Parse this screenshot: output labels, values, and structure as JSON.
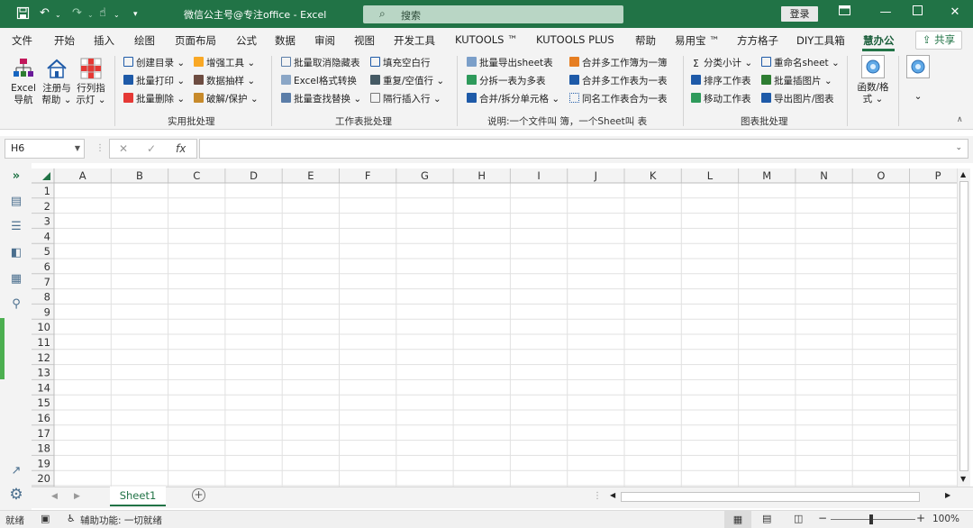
{
  "window": {
    "title": "微信公主号@专注office  -  Excel",
    "search_placeholder": "搜索",
    "login_label": "登录"
  },
  "menu": {
    "items": [
      "文件",
      "开始",
      "插入",
      "绘图",
      "页面布局",
      "公式",
      "数据",
      "审阅",
      "视图",
      "开发工具",
      "KUTOOLS ™",
      "KUTOOLS PLUS",
      "帮助",
      "易用宝 ™",
      "方方格子",
      "DIY工具箱",
      "慧办公"
    ],
    "active": "慧办公",
    "share_label": "共享"
  },
  "ribbon": {
    "big_buttons": [
      "Excel\n导航",
      "注册与\n帮助 ⌄",
      "行列指\n示灯 ⌄"
    ],
    "group1": {
      "label": "实用批处理",
      "col1": [
        "创建目录 ⌄",
        "批量打印 ⌄",
        "批量删除 ⌄"
      ],
      "col2": [
        "增强工具 ⌄",
        "数据抽样 ⌄",
        "破解/保护 ⌄"
      ]
    },
    "group2": {
      "label": "工作表批处理",
      "col1": [
        "批量取消隐藏表",
        "Excel格式转换",
        "批量查找替换 ⌄"
      ],
      "col2": [
        "填充空白行",
        "重复/空值行 ⌄",
        "隔行插入行 ⌄"
      ]
    },
    "group3": {
      "label": "说明:一个文件叫 簿，一个Sheet叫 表",
      "col1": [
        "批量导出sheet表",
        "分拆一表为多表",
        "合并/拆分单元格 ⌄"
      ],
      "col2": [
        "合并多工作簿为一簿",
        "合并多工作表为一表",
        "同名工作表合为一表"
      ]
    },
    "group4": {
      "label": "图表批处理",
      "col1": [
        "分类小计 ⌄",
        "排序工作表",
        "移动工作表"
      ],
      "col2": [
        "重命名sheet ⌄",
        "批量插图片 ⌄",
        "导出图片/图表"
      ]
    },
    "func_button": "函数/格\n式 ⌄",
    "more_glyph": "⌄"
  },
  "formula_bar": {
    "name_box": "H6",
    "cancel_glyph": "✕",
    "enter_glyph": "✓",
    "fx_glyph": "fx",
    "formula": ""
  },
  "grid": {
    "columns": [
      "A",
      "B",
      "C",
      "D",
      "E",
      "F",
      "G",
      "H",
      "I",
      "J",
      "K",
      "L",
      "M",
      "N",
      "O",
      "P"
    ],
    "rows": [
      "1",
      "2",
      "3",
      "4",
      "5",
      "6",
      "7",
      "8",
      "9",
      "10",
      "11",
      "12",
      "13",
      "14",
      "15",
      "16",
      "17",
      "18",
      "19",
      "20"
    ]
  },
  "sheets": {
    "tabs": [
      "Sheet1"
    ],
    "add_glyph": "+"
  },
  "status": {
    "ready": "就绪",
    "accessibility": "辅助功能: 一切就绪",
    "zoom": "100%"
  },
  "colors": {
    "accent": "#217346",
    "title_bar": "#217346",
    "ribbon_bg": "#f3f3f3",
    "sidepanel_accent": "#4caf50"
  },
  "icons": {
    "save": "save-icon",
    "undo": "undo-icon",
    "redo": "redo-icon",
    "touch": "touch-mode-icon",
    "customize": "customize-qat-icon",
    "search": "search-icon",
    "ribbon_display": "ribbon-display-icon",
    "minimize": "minimize-icon",
    "restore": "restore-icon",
    "close": "close-icon",
    "settings": "gear-icon",
    "external": "external-link-icon"
  }
}
